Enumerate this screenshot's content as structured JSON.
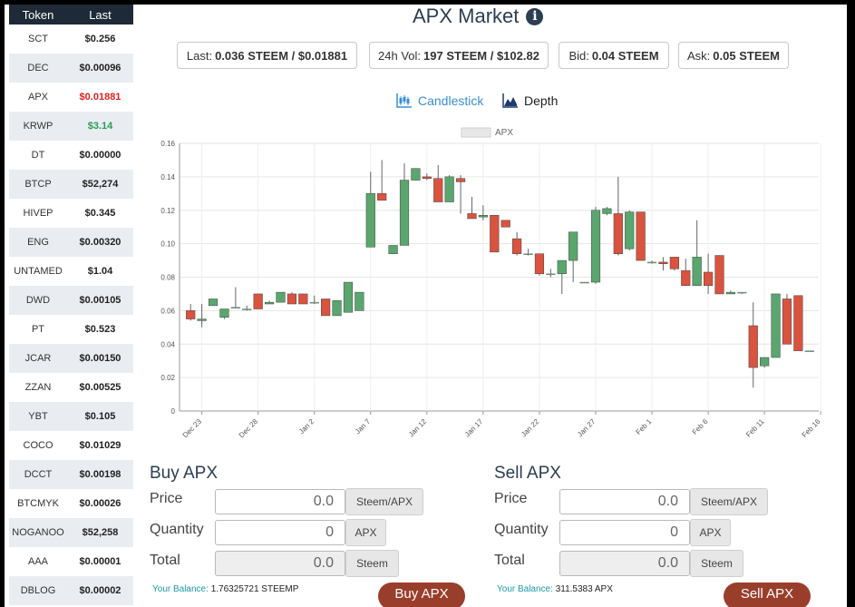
{
  "sidebar": {
    "header": {
      "token": "Token",
      "last": "Last"
    },
    "rows": [
      {
        "token": "SCT",
        "last": "$0.256",
        "color": "#222222"
      },
      {
        "token": "DEC",
        "last": "$0.00096",
        "color": "#222222"
      },
      {
        "token": "APX",
        "last": "$0.01881",
        "color": "#e01f1f"
      },
      {
        "token": "KRWP",
        "last": "$3.14",
        "color": "#2e9a57"
      },
      {
        "token": "DT",
        "last": "$0.00000",
        "color": "#222222"
      },
      {
        "token": "BTCP",
        "last": "$52,274",
        "color": "#222222"
      },
      {
        "token": "HIVEP",
        "last": "$0.345",
        "color": "#222222"
      },
      {
        "token": "ENG",
        "last": "$0.00320",
        "color": "#222222"
      },
      {
        "token": "UNTAMED",
        "last": "$1.04",
        "color": "#222222"
      },
      {
        "token": "DWD",
        "last": "$0.00105",
        "color": "#222222"
      },
      {
        "token": "PT",
        "last": "$0.523",
        "color": "#222222"
      },
      {
        "token": "JCAR",
        "last": "$0.00150",
        "color": "#222222"
      },
      {
        "token": "ZZAN",
        "last": "$0.00525",
        "color": "#222222"
      },
      {
        "token": "YBT",
        "last": "$0.105",
        "color": "#222222"
      },
      {
        "token": "COCO",
        "last": "$0.01029",
        "color": "#222222"
      },
      {
        "token": "DCCT",
        "last": "$0.00198",
        "color": "#222222"
      },
      {
        "token": "BTCMYK",
        "last": "$0.00026",
        "color": "#222222"
      },
      {
        "token": "NOGANOO",
        "last": "$52,258",
        "color": "#222222"
      },
      {
        "token": "AAA",
        "last": "$0.00001",
        "color": "#222222"
      },
      {
        "token": "DBLOG",
        "last": "$0.00002",
        "color": "#222222"
      }
    ]
  },
  "header": {
    "title": "APX Market",
    "info_icon": "i",
    "stats": [
      {
        "label": "Last:",
        "value": "0.036 STEEM / $0.01881"
      },
      {
        "label": "24h Vol:",
        "value": "197 STEEM / $102.82"
      },
      {
        "label": "Bid:",
        "value": "0.04 STEEM"
      },
      {
        "label": "Ask:",
        "value": "0.05 STEEM"
      }
    ]
  },
  "chart_types": {
    "candlestick": "Candlestick",
    "depth": "Depth",
    "active_color": "#3a8fd4"
  },
  "chart_data": {
    "type": "candlestick",
    "legend": [
      "APX"
    ],
    "ylim": [
      0,
      0.16
    ],
    "y_ticks": [
      "0",
      "0.02",
      "0.04",
      "0.06",
      "0.08",
      "0.10",
      "0.12",
      "0.14",
      "0.16"
    ],
    "x_ticks": [
      "Dec 23",
      "Dec 28",
      "Jan 2",
      "Jan 7",
      "Jan 12",
      "Jan 17",
      "Jan 22",
      "Jan 27",
      "Feb 1",
      "Feb 6",
      "Feb 11",
      "Feb 16"
    ],
    "up_color": "#5aa66e",
    "down_color": "#d9533e",
    "candles": [
      [
        0.06,
        0.064,
        0.054,
        0.055
      ],
      [
        0.054,
        0.064,
        0.05,
        0.055
      ],
      [
        0.063,
        0.067,
        0.063,
        0.067
      ],
      [
        0.056,
        0.061,
        0.055,
        0.061
      ],
      [
        0.062,
        0.074,
        0.062,
        0.062
      ],
      [
        0.061,
        0.063,
        0.06,
        0.061
      ],
      [
        0.07,
        0.07,
        0.061,
        0.061
      ],
      [
        0.064,
        0.066,
        0.064,
        0.065
      ],
      [
        0.065,
        0.071,
        0.065,
        0.071
      ],
      [
        0.07,
        0.071,
        0.064,
        0.064
      ],
      [
        0.07,
        0.07,
        0.064,
        0.064
      ],
      [
        0.065,
        0.069,
        0.064,
        0.065
      ],
      [
        0.067,
        0.067,
        0.057,
        0.057
      ],
      [
        0.057,
        0.066,
        0.057,
        0.066
      ],
      [
        0.059,
        0.077,
        0.059,
        0.077
      ],
      [
        0.06,
        0.071,
        0.06,
        0.071
      ],
      [
        0.098,
        0.143,
        0.098,
        0.13
      ],
      [
        0.13,
        0.15,
        0.126,
        0.126
      ],
      [
        0.094,
        0.099,
        0.094,
        0.099
      ],
      [
        0.099,
        0.148,
        0.099,
        0.138
      ],
      [
        0.138,
        0.145,
        0.138,
        0.145
      ],
      [
        0.14,
        0.142,
        0.138,
        0.139
      ],
      [
        0.139,
        0.147,
        0.125,
        0.125
      ],
      [
        0.125,
        0.141,
        0.125,
        0.14
      ],
      [
        0.139,
        0.141,
        0.118,
        0.137
      ],
      [
        0.118,
        0.128,
        0.115,
        0.115
      ],
      [
        0.116,
        0.123,
        0.114,
        0.117
      ],
      [
        0.117,
        0.117,
        0.095,
        0.095
      ],
      [
        0.114,
        0.114,
        0.11,
        0.11
      ],
      [
        0.103,
        0.107,
        0.093,
        0.094
      ],
      [
        0.094,
        0.097,
        0.093,
        0.094
      ],
      [
        0.094,
        0.094,
        0.081,
        0.082
      ],
      [
        0.082,
        0.085,
        0.08,
        0.082
      ],
      [
        0.082,
        0.089,
        0.07,
        0.09
      ],
      [
        0.09,
        0.107,
        0.077,
        0.107
      ],
      [
        0.077,
        0.077,
        0.077,
        0.077
      ],
      [
        0.077,
        0.122,
        0.076,
        0.12
      ],
      [
        0.118,
        0.122,
        0.117,
        0.121
      ],
      [
        0.118,
        0.14,
        0.093,
        0.094
      ],
      [
        0.097,
        0.12,
        0.096,
        0.119
      ],
      [
        0.119,
        0.119,
        0.09,
        0.09
      ],
      [
        0.089,
        0.09,
        0.088,
        0.089
      ],
      [
        0.089,
        0.092,
        0.084,
        0.088
      ],
      [
        0.092,
        0.092,
        0.084,
        0.085
      ],
      [
        0.084,
        0.091,
        0.075,
        0.075
      ],
      [
        0.075,
        0.114,
        0.075,
        0.092
      ],
      [
        0.083,
        0.094,
        0.07,
        0.075
      ],
      [
        0.093,
        0.093,
        0.07,
        0.07
      ],
      [
        0.07,
        0.072,
        0.07,
        0.071
      ],
      [
        0.071,
        0.071,
        0.07,
        0.071
      ],
      [
        0.051,
        0.065,
        0.014,
        0.026
      ],
      [
        0.027,
        0.032,
        0.026,
        0.032
      ],
      [
        0.032,
        0.07,
        0.032,
        0.07
      ],
      [
        0.067,
        0.07,
        0.04,
        0.04
      ],
      [
        0.069,
        0.069,
        0.036,
        0.036
      ],
      [
        0.036,
        0.036,
        0.036,
        0.036
      ]
    ]
  },
  "buy": {
    "title": "Buy APX",
    "price_label": "Price",
    "price_value": "0.0",
    "price_unit": "Steem/APX",
    "qty_label": "Quantity",
    "qty_value": "0",
    "qty_unit": "APX",
    "total_label": "Total",
    "total_value": "0.0",
    "total_unit": "Steem",
    "balance_label": "Your Balance:",
    "balance_value": "1.76325721 STEEMP",
    "button": "Buy APX"
  },
  "sell": {
    "title": "Sell APX",
    "price_label": "Price",
    "price_value": "0.0",
    "price_unit": "Steem/APX",
    "qty_label": "Quantity",
    "qty_value": "0",
    "qty_unit": "APX",
    "total_label": "Total",
    "total_value": "0.0",
    "total_unit": "Steem",
    "balance_label": "Your Balance:",
    "balance_value": "311.5383 APX",
    "button": "Sell APX"
  }
}
